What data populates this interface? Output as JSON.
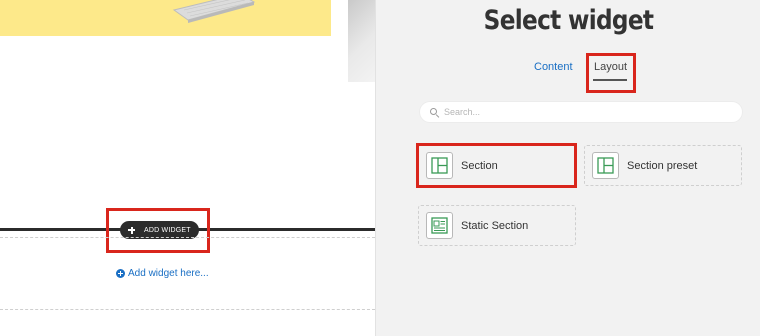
{
  "editor": {
    "add_widget_button": "ADD WIDGET",
    "add_widget_here_link": "Add widget here..."
  },
  "panel": {
    "title": "Select widget",
    "tabs": [
      {
        "label": "Content",
        "active": false
      },
      {
        "label": "Layout",
        "active": true
      }
    ],
    "search": {
      "placeholder": "Search...",
      "value": ""
    },
    "widgets": [
      {
        "label": "Section",
        "icon": "section-layout-icon"
      },
      {
        "label": "Section preset",
        "icon": "section-preset-icon"
      },
      {
        "label": "Static Section",
        "icon": "static-section-icon"
      }
    ]
  },
  "colors": {
    "accent": "#1a6fc4",
    "highlight": "#d9261c",
    "icon_green": "#3a9a56",
    "banner_yellow": "#fde98a"
  }
}
